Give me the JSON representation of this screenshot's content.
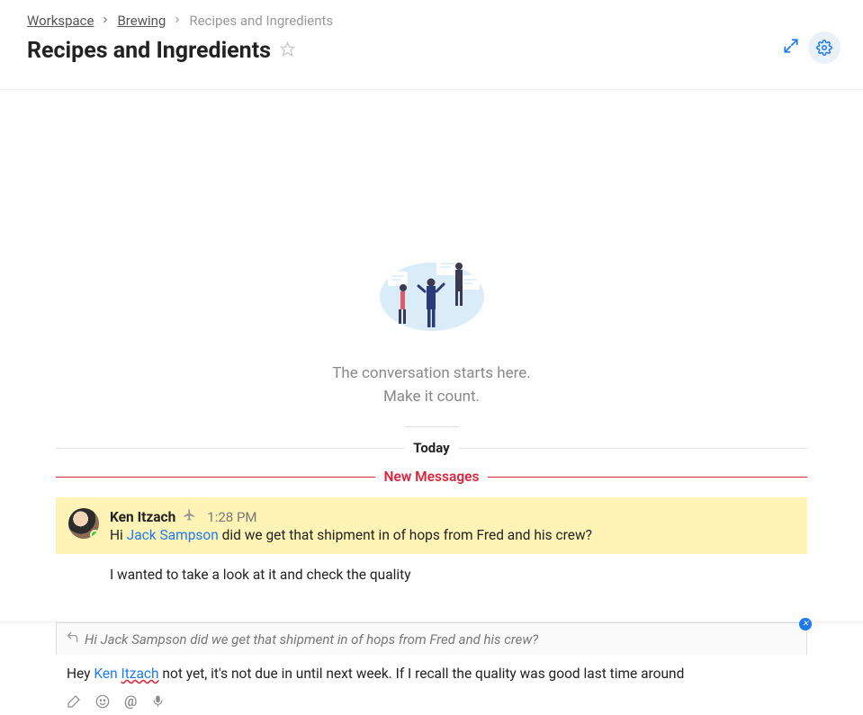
{
  "breadcrumb": {
    "root": "Workspace",
    "parent": "Brewing",
    "current": "Recipes and Ingredients"
  },
  "page": {
    "title": "Recipes and Ingredients"
  },
  "empty_state": {
    "line1": "The conversation starts here.",
    "line2": "Make it count."
  },
  "day_label": "Today",
  "new_messages_label": "New Messages",
  "message": {
    "author": "Ken Itzach",
    "time": "1:28 PM",
    "text_prefix": "Hi ",
    "mention": "Jack Sampson",
    "text_suffix": " did we get that shipment in of hops from  Fred and his crew?",
    "followup": "I wanted to take a look at it and check the quality"
  },
  "reply_context": {
    "text": "Hi Jack Sampson did we get that shipment in of hops from Fred and his crew?"
  },
  "composer": {
    "text_prefix": "Hey ",
    "mention_first": "Ken ",
    "mention_last": "Itzach",
    "text_suffix": " not yet, it's not due in until next week. If I recall the quality was good last time around"
  }
}
